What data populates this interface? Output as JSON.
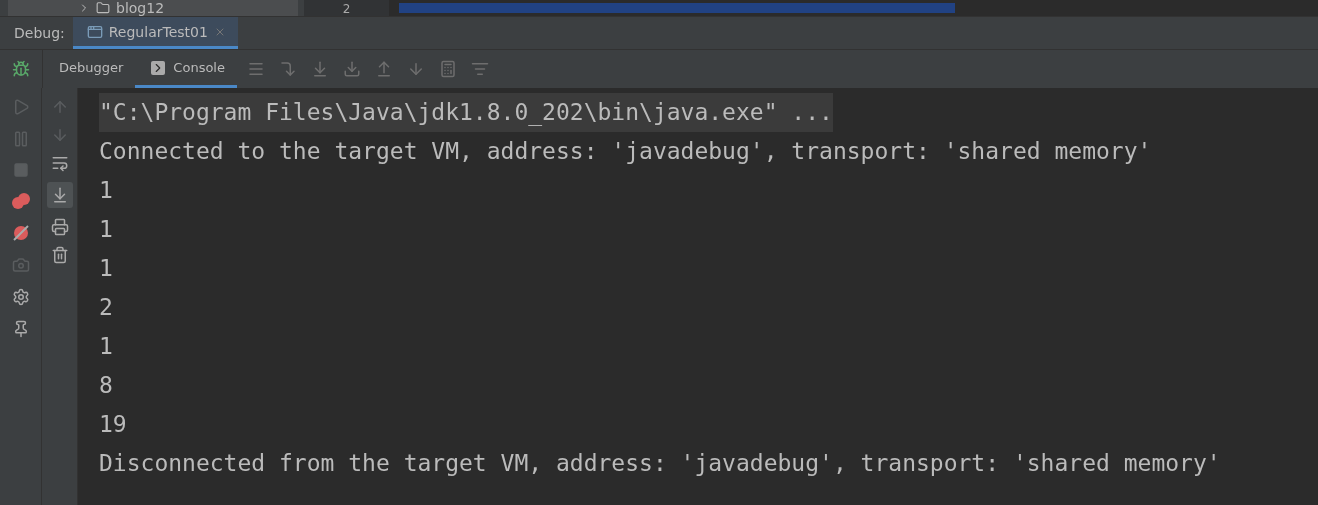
{
  "top_strip": {
    "tree_item": "blog12",
    "line_number": "2"
  },
  "debug_bar": {
    "label": "Debug:",
    "tabs": [
      {
        "label": "RegularTest01",
        "selected": true
      }
    ]
  },
  "toolbar": {
    "tabs": [
      {
        "label": "Debugger",
        "selected": false
      },
      {
        "label": "Console",
        "selected": true
      }
    ]
  },
  "side_tools": {
    "scroll_to_end": {
      "on": true
    }
  },
  "console": {
    "lines": [
      {
        "text": "\"C:\\Program Files\\Java\\jdk1.8.0_202\\bin\\java.exe\" ...",
        "highlighted": true
      },
      {
        "text": "Connected to the target VM, address: 'javadebug', transport: 'shared memory'",
        "highlighted": false
      },
      {
        "text": "1",
        "highlighted": false
      },
      {
        "text": "1",
        "highlighted": false
      },
      {
        "text": "1",
        "highlighted": false
      },
      {
        "text": "2",
        "highlighted": false
      },
      {
        "text": "1",
        "highlighted": false
      },
      {
        "text": "8",
        "highlighted": false
      },
      {
        "text": "19",
        "highlighted": false
      },
      {
        "text": "Disconnected from the target VM, address: 'javadebug', transport: 'shared memory'",
        "highlighted": false
      }
    ]
  }
}
